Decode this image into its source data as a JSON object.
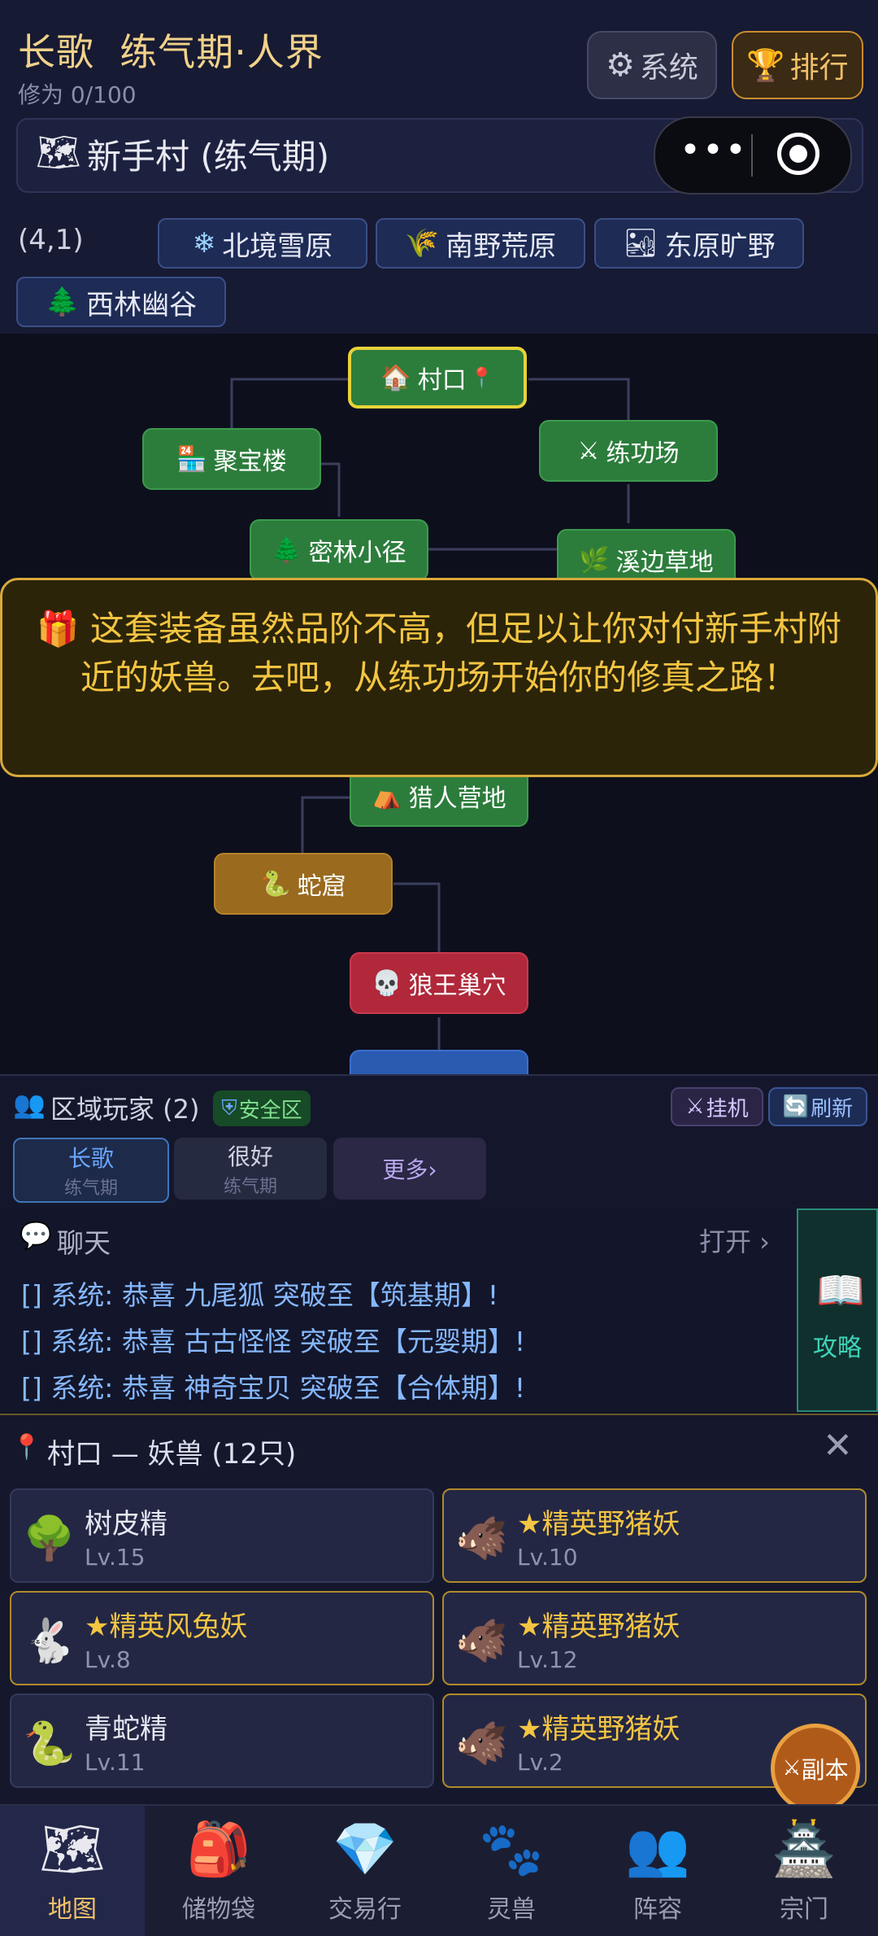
{
  "header": {
    "name": "长歌",
    "realm": "练气期·人界",
    "cultivation": "修为 0/100",
    "system_label": "系统",
    "rank_label": "排行",
    "location": "新手村 (练气期)",
    "coords": "(4,1)"
  },
  "regions": [
    "北境雪原",
    "南野荒原",
    "东原旷野",
    "西林幽谷"
  ],
  "map": {
    "nodes": {
      "village": "村口",
      "juBao": "聚宝楼",
      "training": "练功场",
      "forest": "密林小径",
      "creek": "溪边草地",
      "hunter": "猎人营地",
      "snake": "蛇窟",
      "wolf": "狼王巢穴"
    }
  },
  "banner": {
    "text": "这套装备虽然品阶不高，但足以让你对付新手村附近的妖兽。去吧，从练功场开始你的修真之路！"
  },
  "players": {
    "title": "区域玩家 (2)",
    "safe_zone": "安全区",
    "afk_label": "挂机",
    "refresh_label": "刷新",
    "list": [
      {
        "name": "长歌",
        "realm": "练气期"
      },
      {
        "name": "很好",
        "realm": "练气期"
      }
    ],
    "more_label": "更多›"
  },
  "chat": {
    "title": "聊天",
    "open_label": "打开 ›",
    "messages": [
      "[] 系统: 恭喜 九尾狐 突破至【筑基期】!",
      "[] 系统: 恭喜 古古怪怪 突破至【元婴期】!",
      "[] 系统: 恭喜 神奇宝贝 突破至【合体期】!"
    ],
    "guide_label": "攻略"
  },
  "monsters": {
    "title": "村口 — 妖兽 (12只)",
    "list": [
      {
        "name": "树皮精",
        "level": "Lv.15",
        "elite": false,
        "icon": "🌳"
      },
      {
        "name": "★精英野猪妖",
        "level": "Lv.10",
        "elite": true,
        "icon": "🐗"
      },
      {
        "name": "★精英风兔妖",
        "level": "Lv.8",
        "elite": true,
        "icon": "🐇"
      },
      {
        "name": "★精英野猪妖",
        "level": "Lv.12",
        "elite": true,
        "icon": "🐗"
      },
      {
        "name": "青蛇精",
        "level": "Lv.11",
        "elite": false,
        "icon": "🐍"
      },
      {
        "name": "★精英野猪妖",
        "level": "Lv.2",
        "elite": true,
        "icon": "🐗"
      }
    ],
    "dungeon_label": "副本"
  },
  "tabs": [
    "地图",
    "储物袋",
    "交易行",
    "灵兽",
    "阵容",
    "宗门"
  ],
  "colors": {
    "accent": "#f2c069",
    "node_green": "#2c7d3c",
    "node_brown": "#9a6a1e",
    "node_red": "#b0283a"
  }
}
